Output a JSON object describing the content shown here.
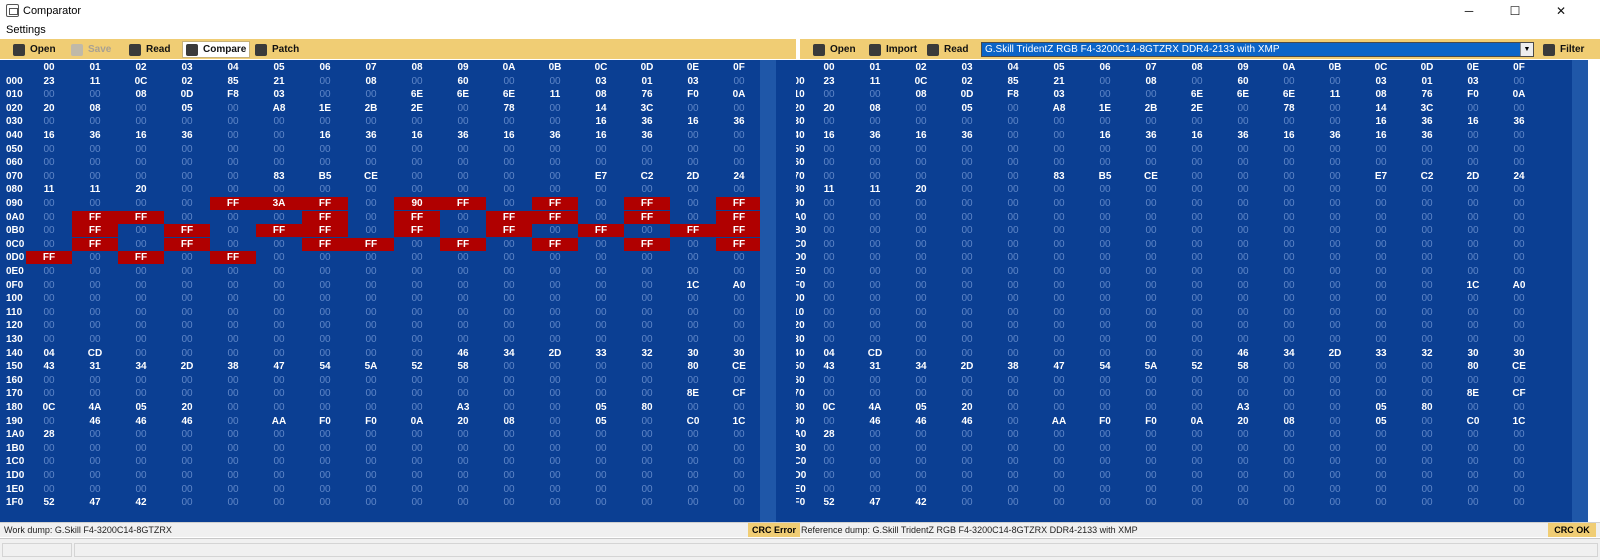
{
  "window": {
    "title": "Comparator",
    "minimize": "─",
    "maximize": "☐",
    "close": "✕"
  },
  "menu": {
    "settings": "Settings"
  },
  "left_toolbar": {
    "open": "Open",
    "save": "Save",
    "read": "Read",
    "compare": "Compare",
    "patch": "Patch"
  },
  "right_toolbar": {
    "open": "Open",
    "import": "Import",
    "read": "Read",
    "filter": "Filter",
    "reference_select": "G.Skill TridentZ RGB F4-3200C14-8GTZRX DDR4-2133 with XMP"
  },
  "columns": [
    "00",
    "01",
    "02",
    "03",
    "04",
    "05",
    "06",
    "07",
    "08",
    "09",
    "0A",
    "0B",
    "0C",
    "0D",
    "0E",
    "0F"
  ],
  "rows": [
    [
      "000",
      "23 11 0C 02 85 21 00 08 00 60 00 00 03 01 03 00"
    ],
    [
      "010",
      "00 00 08 0D F8 03 00 00 6E 6E 6E 11 08 76 F0 0A"
    ],
    [
      "020",
      "20 08 00 05 00 A8 1E 2B 2E 00 78 00 14 3C 00 00"
    ],
    [
      "030",
      "00 00 00 00 00 00 00 00 00 00 00 00 16 36 16 36"
    ],
    [
      "040",
      "16 36 16 36 00 00 16 36 16 36 16 36 16 36 00 00"
    ],
    [
      "050",
      "00 00 00 00 00 00 00 00 00 00 00 00 00 00 00 00"
    ],
    [
      "060",
      "00 00 00 00 00 00 00 00 00 00 00 00 00 00 00 00"
    ],
    [
      "070",
      "00 00 00 00 00 83 B5 CE 00 00 00 00 E7 C2 2D 24"
    ],
    [
      "080",
      "11 11 20 00 00 00 00 00 00 00 00 00 00 00 00 00"
    ],
    [
      "090",
      "00 00 00 00 00 00 00 00 00 00 00 00 00 00 00 00"
    ],
    [
      "0A0",
      "00 00 00 00 00 00 00 00 00 00 00 00 00 00 00 00"
    ],
    [
      "0B0",
      "00 00 00 00 00 00 00 00 00 00 00 00 00 00 00 00"
    ],
    [
      "0C0",
      "00 00 00 00 00 00 00 00 00 00 00 00 00 00 00 00"
    ],
    [
      "0D0",
      "00 00 00 00 00 00 00 00 00 00 00 00 00 00 00 00"
    ],
    [
      "0E0",
      "00 00 00 00 00 00 00 00 00 00 00 00 00 00 00 00"
    ],
    [
      "0F0",
      "00 00 00 00 00 00 00 00 00 00 00 00 00 00 1C A0"
    ],
    [
      "100",
      "00 00 00 00 00 00 00 00 00 00 00 00 00 00 00 00"
    ],
    [
      "110",
      "00 00 00 00 00 00 00 00 00 00 00 00 00 00 00 00"
    ],
    [
      "120",
      "00 00 00 00 00 00 00 00 00 00 00 00 00 00 00 00"
    ],
    [
      "130",
      "00 00 00 00 00 00 00 00 00 00 00 00 00 00 00 00"
    ],
    [
      "140",
      "04 CD 00 00 00 00 00 00 00 46 34 2D 33 32 30 30"
    ],
    [
      "150",
      "43 31 34 2D 38 47 54 5A 52 58 00 00 00 00 80 CE"
    ],
    [
      "160",
      "00 00 00 00 00 00 00 00 00 00 00 00 00 00 00 00"
    ],
    [
      "170",
      "00 00 00 00 00 00 00 00 00 00 00 00 00 00 8E CF"
    ],
    [
      "180",
      "0C 4A 05 20 00 00 00 00 00 A3 00 00 05 80 00 00"
    ],
    [
      "190",
      "00 46 46 46 00 AA F0 F0 0A 20 08 00 05 00 C0 1C"
    ],
    [
      "1A0",
      "28 00 00 00 00 00 00 00 00 00 00 00 00 00 00 00"
    ],
    [
      "1B0",
      "00 00 00 00 00 00 00 00 00 00 00 00 00 00 00 00"
    ],
    [
      "1C0",
      "00 00 00 00 00 00 00 00 00 00 00 00 00 00 00 00"
    ],
    [
      "1D0",
      "00 00 00 00 00 00 00 00 00 00 00 00 00 00 00 00"
    ],
    [
      "1E0",
      "00 00 00 00 00 00 00 00 00 00 00 00 00 00 00 00"
    ],
    [
      "1F0",
      "52 47 42 00 00 00 00 00 00 00 00 00 00 00 00 00"
    ]
  ],
  "work_diffs": {
    "090": {
      "04": "FF",
      "05": "3A",
      "06": "FF",
      "08": "90",
      "09": "FF",
      "0B": "FF",
      "0D": "FF",
      "0F": "FF"
    },
    "0A0": {
      "01": "FF",
      "02": "FF",
      "06": "FF",
      "08": "FF",
      "0A": "FF",
      "0B": "FF",
      "0D": "FF",
      "0F": "FF"
    },
    "0B0": {
      "01": "FF",
      "03": "FF",
      "05": "FF",
      "06": "FF",
      "08": "FF",
      "0A": "FF",
      "0C": "FF",
      "0E": "FF",
      "0F": "FF"
    },
    "0C0": {
      "01": "FF",
      "03": "FF",
      "06": "FF",
      "07": "FF",
      "09": "FF",
      "0B": "FF",
      "0D": "FF",
      "0F": "FF"
    },
    "0D0": {
      "00": "FF",
      "02": "FF",
      "04": "FF"
    }
  },
  "status": {
    "work_dump": "Work dump: G.Skill F4-3200C14-8GTZRX",
    "work_crc": "CRC Error",
    "reference_dump": "Reference dump: G.Skill TridentZ RGB F4-3200C14-8GTZRX DDR4-2133 with XMP",
    "reference_crc": "CRC OK"
  },
  "colors": {
    "panel_bg": "#0b3f93",
    "diff_bg": "#b00000",
    "toolbar_bg": "#f0cd74",
    "zero_text": "#5f86c7"
  },
  "icons": {
    "open": "folder-icon",
    "save": "disk-icon",
    "read": "chip-read-icon",
    "compare": "compare-icon",
    "patch": "check-icon",
    "import": "import-arrow-icon",
    "filter": "filter-icon"
  }
}
